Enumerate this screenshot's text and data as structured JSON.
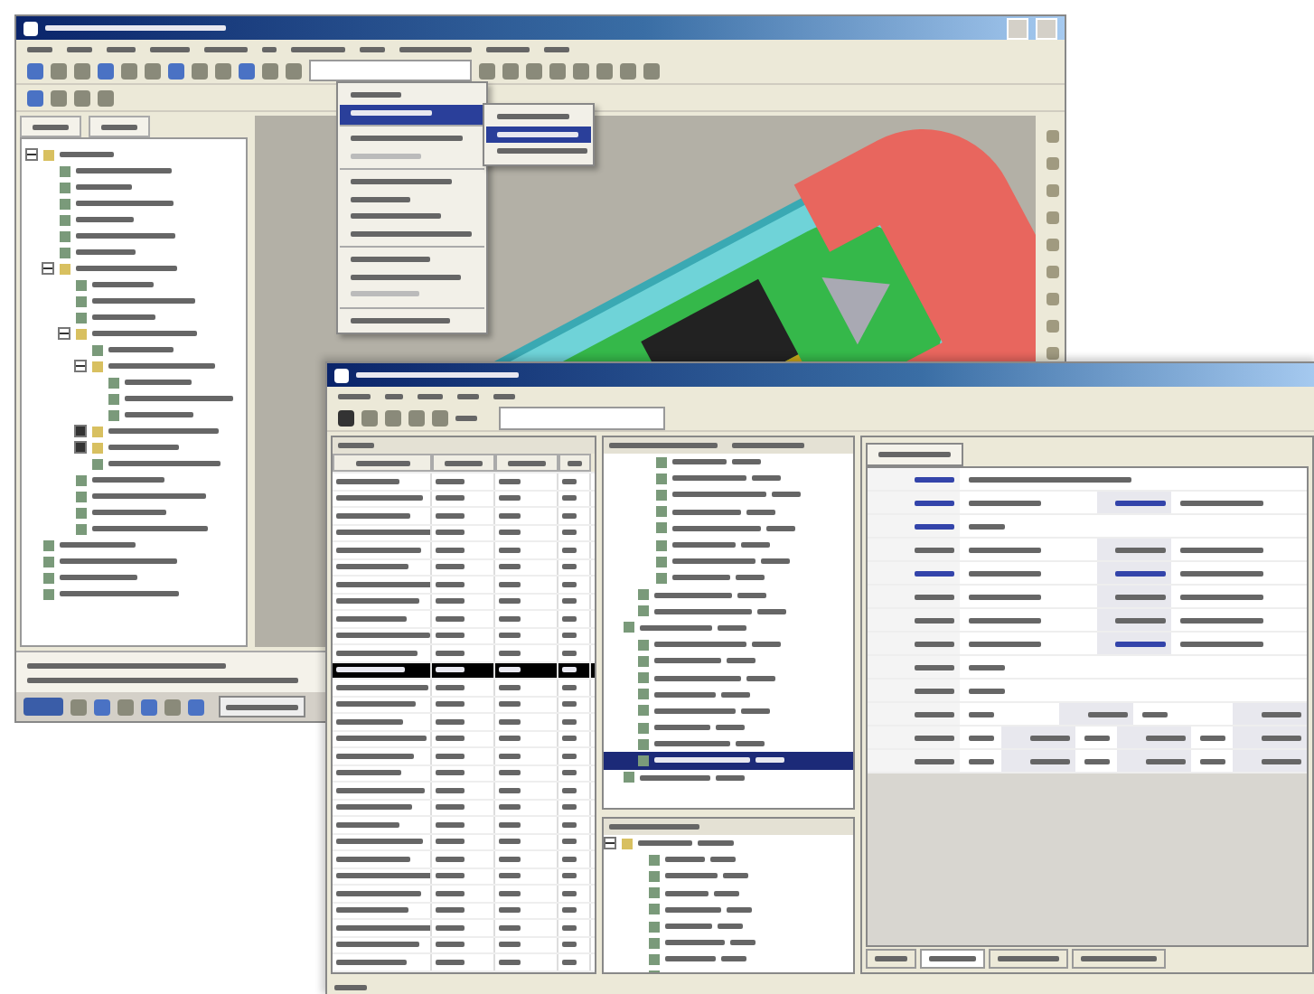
{
  "back_window": {
    "dropdown_menu": [
      {
        "selected": false,
        "disabled": false,
        "separator_after": false
      },
      {
        "selected": true,
        "disabled": false,
        "separator_after": true
      },
      {
        "selected": false,
        "disabled": false,
        "separator_after": false
      },
      {
        "selected": false,
        "disabled": true,
        "separator_after": true
      },
      {
        "selected": false,
        "disabled": false,
        "separator_after": false
      },
      {
        "selected": false,
        "disabled": false,
        "separator_after": false
      },
      {
        "selected": false,
        "disabled": false,
        "separator_after": false
      },
      {
        "selected": false,
        "disabled": false,
        "separator_after": true
      },
      {
        "selected": false,
        "disabled": false,
        "separator_after": false
      },
      {
        "selected": false,
        "disabled": false,
        "separator_after": false
      },
      {
        "selected": false,
        "disabled": true,
        "separator_after": true
      },
      {
        "selected": false,
        "disabled": false,
        "separator_after": false
      }
    ],
    "submenu": [
      {
        "selected": false
      },
      {
        "selected": true
      },
      {
        "selected": false
      }
    ],
    "tree": [
      {
        "kind": "folder",
        "expanded": true,
        "children": [
          {
            "kind": "part"
          },
          {
            "kind": "part"
          },
          {
            "kind": "part"
          },
          {
            "kind": "part"
          },
          {
            "kind": "part"
          },
          {
            "kind": "part"
          },
          {
            "kind": "folder",
            "expanded": true,
            "children": [
              {
                "kind": "part"
              },
              {
                "kind": "part"
              },
              {
                "kind": "part"
              },
              {
                "kind": "folder",
                "expanded": true,
                "children": [
                  {
                    "kind": "part"
                  },
                  {
                    "kind": "folder",
                    "expanded": true,
                    "children": [
                      {
                        "kind": "part"
                      },
                      {
                        "kind": "part"
                      },
                      {
                        "kind": "part"
                      }
                    ]
                  },
                  {
                    "kind": "folder",
                    "expanded": false
                  },
                  {
                    "kind": "folder",
                    "expanded": false
                  },
                  {
                    "kind": "part"
                  }
                ]
              },
              {
                "kind": "part"
              },
              {
                "kind": "part"
              },
              {
                "kind": "part"
              },
              {
                "kind": "part"
              }
            ]
          }
        ]
      },
      {
        "kind": "part"
      },
      {
        "kind": "part"
      },
      {
        "kind": "part"
      },
      {
        "kind": "part"
      }
    ]
  },
  "front_window": {
    "list_rows": [
      {
        "selected": false
      },
      {
        "selected": false
      },
      {
        "selected": false
      },
      {
        "selected": false
      },
      {
        "selected": false
      },
      {
        "selected": false
      },
      {
        "selected": false
      },
      {
        "selected": false
      },
      {
        "selected": false
      },
      {
        "selected": false
      },
      {
        "selected": false
      },
      {
        "selected": true
      },
      {
        "selected": false
      },
      {
        "selected": false
      },
      {
        "selected": false
      },
      {
        "selected": false
      },
      {
        "selected": false
      },
      {
        "selected": false
      },
      {
        "selected": false
      },
      {
        "selected": false
      },
      {
        "selected": false
      },
      {
        "selected": false
      },
      {
        "selected": false
      },
      {
        "selected": false
      },
      {
        "selected": false
      },
      {
        "selected": false
      },
      {
        "selected": false
      },
      {
        "selected": false
      },
      {
        "selected": false
      }
    ],
    "upper_tree_rows": [
      {
        "selected": false
      },
      {
        "selected": false
      },
      {
        "selected": false
      },
      {
        "selected": false
      },
      {
        "selected": false
      },
      {
        "selected": false
      },
      {
        "selected": false
      },
      {
        "selected": false
      },
      {
        "selected": false
      },
      {
        "selected": false
      },
      {
        "selected": false
      },
      {
        "selected": false
      },
      {
        "selected": false
      },
      {
        "selected": false
      },
      {
        "selected": false
      },
      {
        "selected": false
      },
      {
        "selected": false
      },
      {
        "selected": false
      },
      {
        "selected": true
      },
      {
        "selected": false
      }
    ],
    "lower_tree": [
      {
        "kind": "folder",
        "expanded": true,
        "children": [
          {
            "kind": "part"
          },
          {
            "kind": "part"
          },
          {
            "kind": "part"
          },
          {
            "kind": "part"
          },
          {
            "kind": "part"
          },
          {
            "kind": "part"
          },
          {
            "kind": "part"
          },
          {
            "kind": "part"
          }
        ]
      }
    ],
    "bottom_tabs": [
      {
        "selected": false
      },
      {
        "selected": true
      },
      {
        "selected": false
      },
      {
        "selected": false
      }
    ]
  }
}
